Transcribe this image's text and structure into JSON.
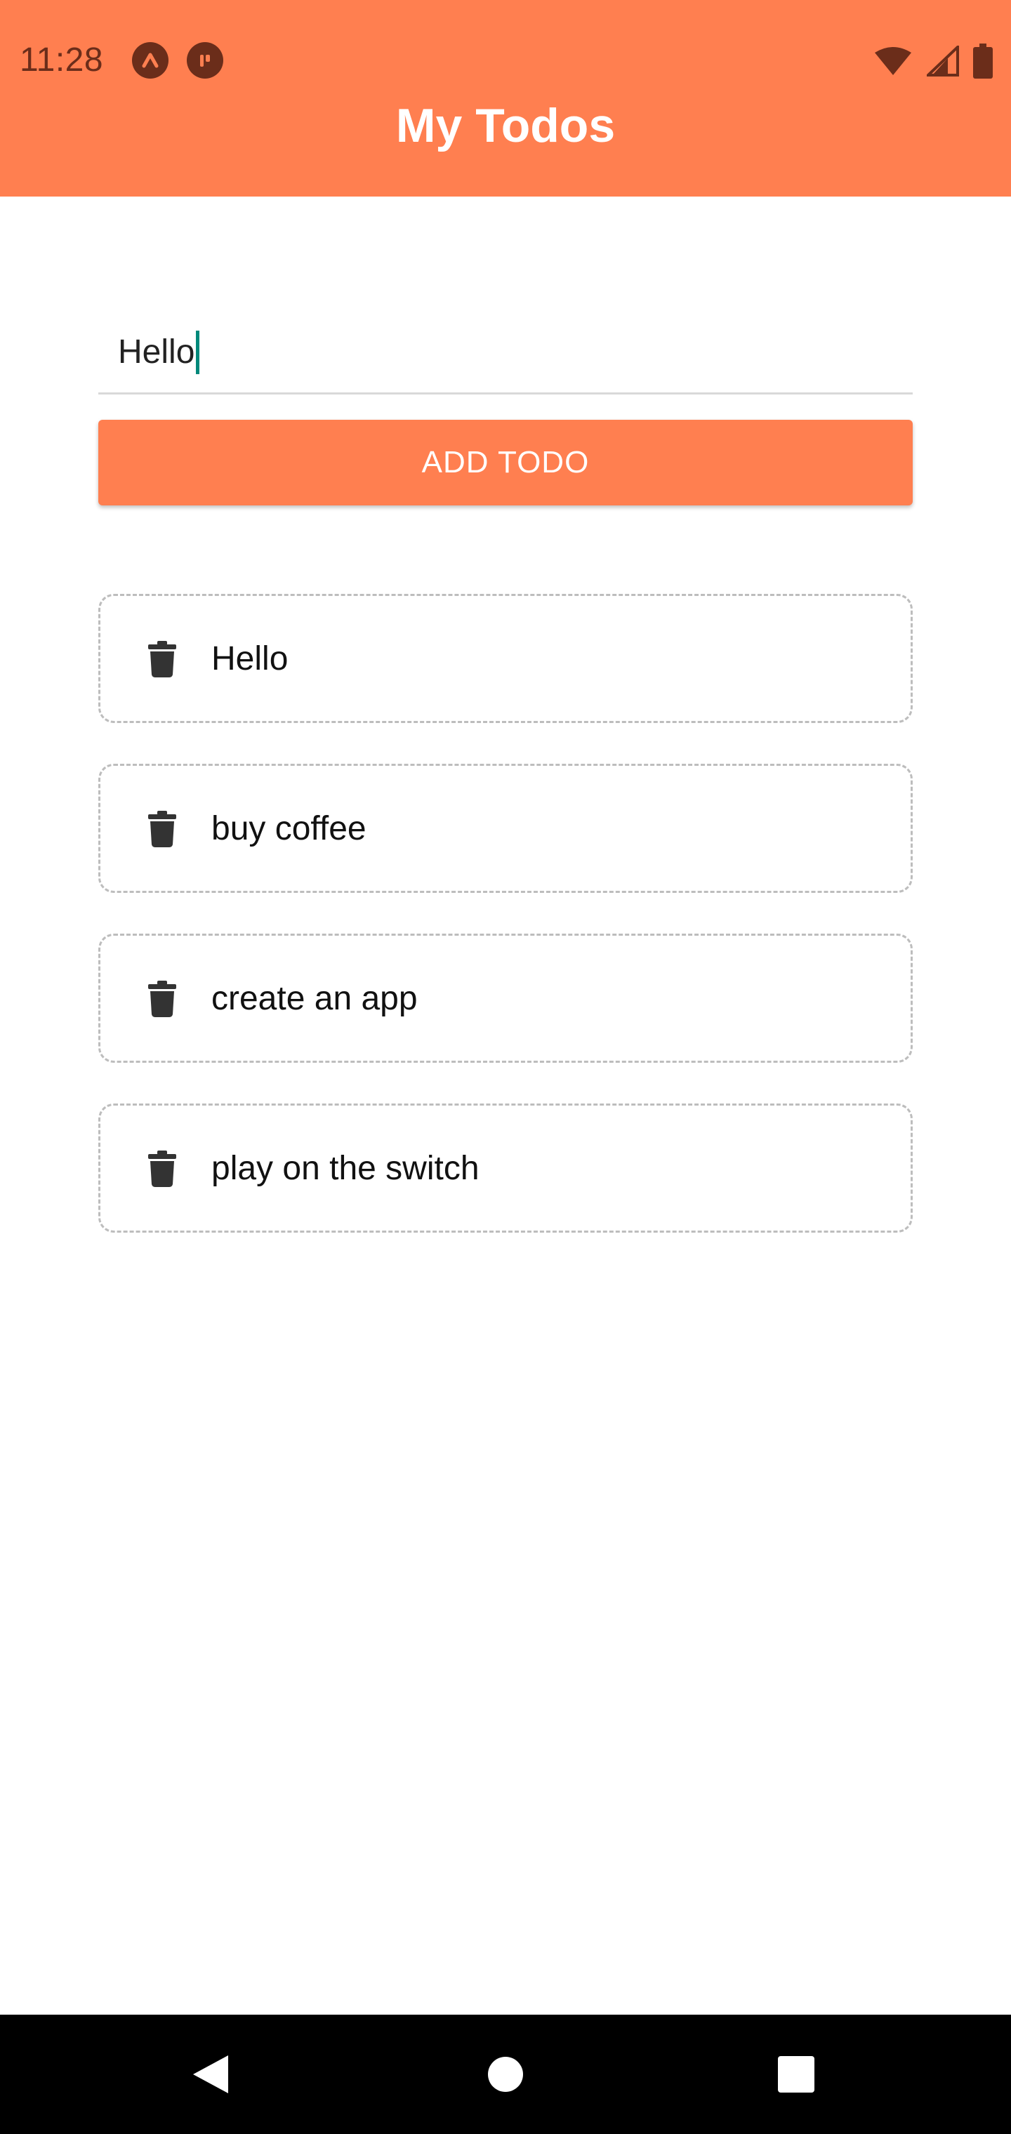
{
  "status_bar": {
    "time": "11:28"
  },
  "header": {
    "title": "My Todos"
  },
  "input": {
    "value": "Hello"
  },
  "add_button": {
    "label": "ADD TODO"
  },
  "todos": [
    {
      "text": "Hello"
    },
    {
      "text": "buy coffee"
    },
    {
      "text": "create an app"
    },
    {
      "text": "play on the switch"
    }
  ],
  "colors": {
    "accent": "#ff7f50",
    "status_icon": "#6b2d1a",
    "cursor": "#00897b"
  }
}
